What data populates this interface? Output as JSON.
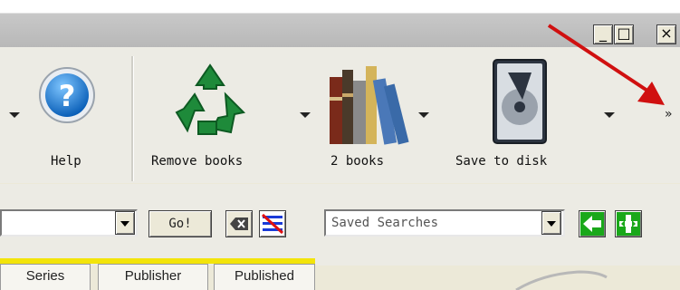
{
  "toolbar": {
    "help_label": "Help",
    "remove_label": "Remove books",
    "books_label": "2 books",
    "save_label": "Save to disk",
    "overflow_label": "»"
  },
  "titlebar": {
    "minimize": "_",
    "maximize": "□",
    "close": "×"
  },
  "search": {
    "go_label": "Go!",
    "saved_searches_placeholder": "Saved Searches"
  },
  "columns": [
    "Series",
    "Publisher",
    "Published"
  ],
  "colors": {
    "highlight": "#f3e40a",
    "annotation_arrow": "#d01010"
  }
}
